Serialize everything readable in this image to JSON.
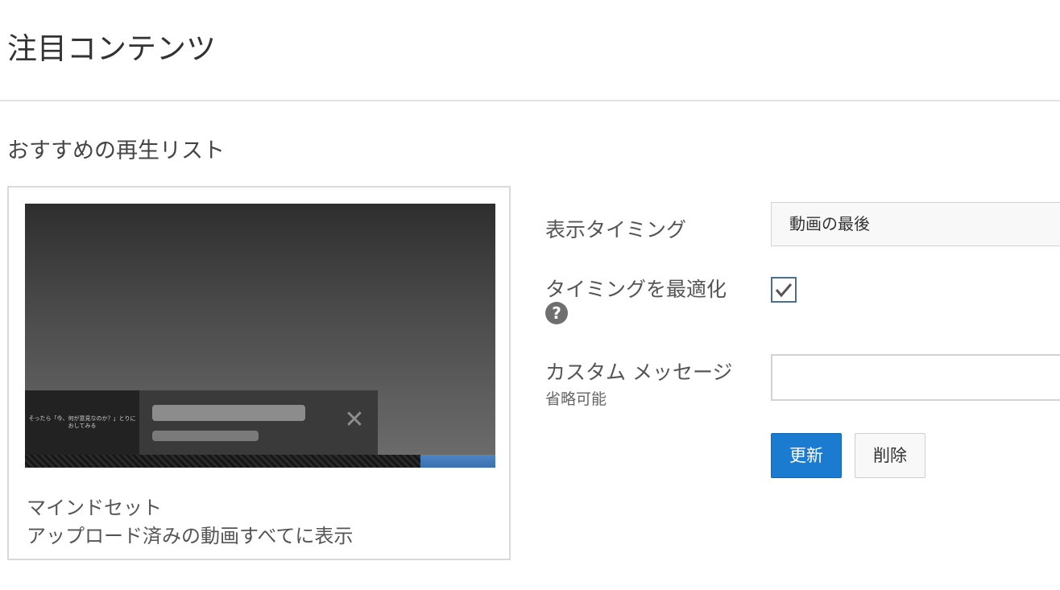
{
  "page_title": "注目コンテンツ",
  "section_title": "おすすめの再生リスト",
  "preview": {
    "endcard_text": "そったら「今、何が意見なのか？」とりにおしてみる",
    "progress_fraction": 0.16
  },
  "card": {
    "name": "マインドセット",
    "description": "アップロード済みの動画すべてに表示"
  },
  "form": {
    "timing_label": "表示タイミング",
    "timing_value": "動画の最後",
    "optimize_label": "タイミングを最適化",
    "optimize_checked": true,
    "help_symbol": "?",
    "custom_message_label": "カスタム メッセージ",
    "custom_message_sublabel": "省略可能",
    "custom_message_value": "",
    "update_button": "更新",
    "delete_button": "削除"
  },
  "colors": {
    "primary_button": "#1a7bd0",
    "progress": "#4f86c6"
  }
}
